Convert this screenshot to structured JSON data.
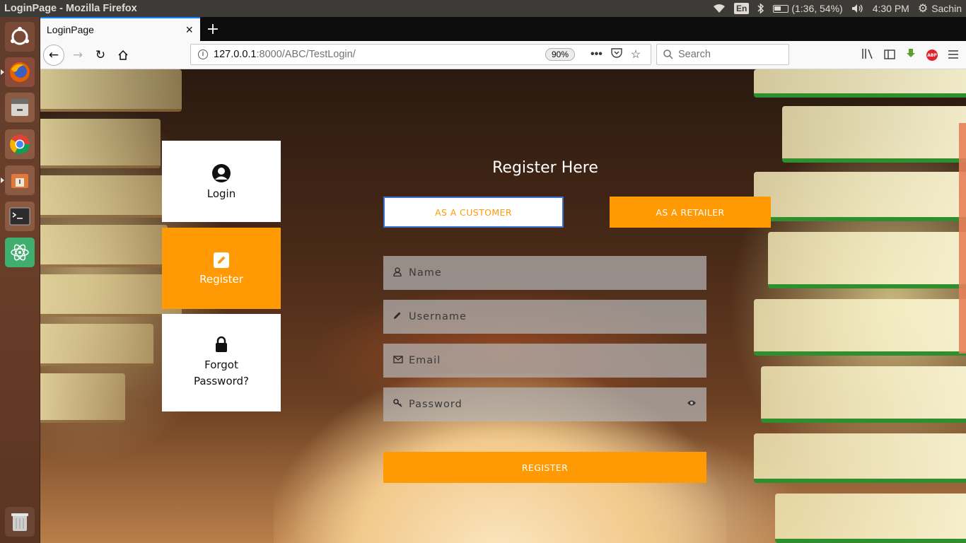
{
  "system_panel": {
    "window_title": "LoginPage - Mozilla Firefox",
    "keyboard_layout": "En",
    "battery_text": "(1:36, 54%)",
    "clock": "4:30 PM",
    "user": "Sachin"
  },
  "launcher": {
    "items": [
      "ubuntu-dash",
      "firefox",
      "files",
      "chrome",
      "archive-manager",
      "terminal",
      "atom",
      "trash"
    ]
  },
  "browser": {
    "tab_title": "LoginPage",
    "url_host": "127.0.0.1",
    "url_rest": ":8000/ABC/TestLogin/",
    "zoom": "90%",
    "search_placeholder": "Search",
    "ui_color": "#0a84ff"
  },
  "page": {
    "accent_color": "#ff9a05",
    "side_menu": {
      "login_label": "Login",
      "register_label": "Register",
      "forgot_label": "Forgot\nPassword?",
      "forgot_line1": "Forgot",
      "forgot_line2": "Password?",
      "active": "Register"
    },
    "heading": "Register Here",
    "as_customer": "AS A CUSTOMER",
    "as_retailer": "AS A RETAILER",
    "fields": {
      "name_placeholder": "Name",
      "username_placeholder": "Username",
      "email_placeholder": "Email",
      "password_placeholder": "Password"
    },
    "register_button": "REGISTER"
  }
}
